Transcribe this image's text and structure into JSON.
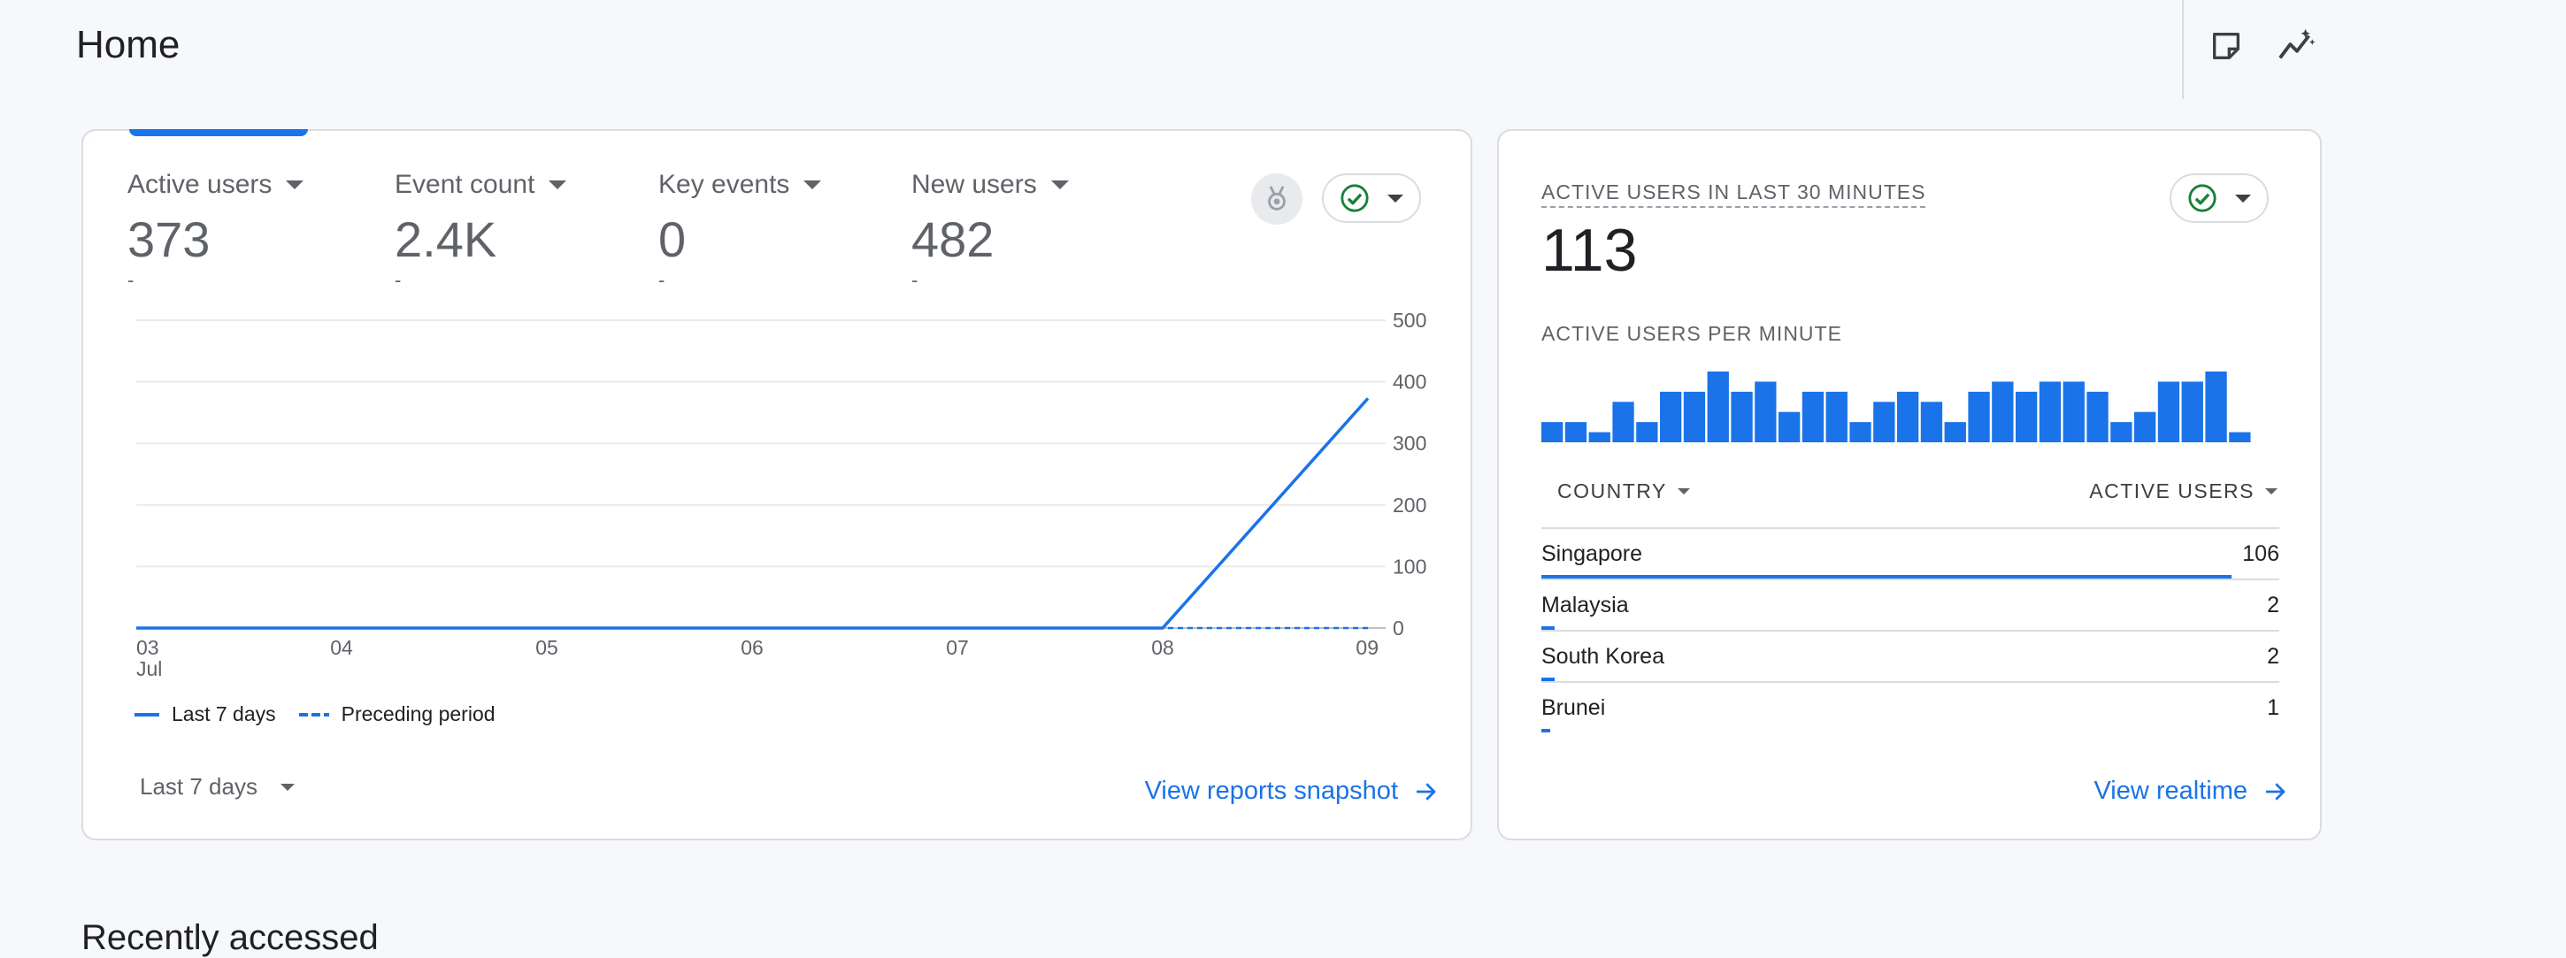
{
  "header": {
    "title": "Home",
    "icons": [
      "notes-icon",
      "insights-icon"
    ]
  },
  "colors": {
    "accent": "#1a73e8",
    "success": "#188038",
    "text": "#202124",
    "muted": "#5f6368"
  },
  "overview": {
    "metrics": [
      {
        "label": "Active users",
        "value": "373",
        "delta": "-",
        "active": true
      },
      {
        "label": "Event count",
        "value": "2.4K",
        "delta": "-",
        "active": false
      },
      {
        "label": "Key events",
        "value": "0",
        "delta": "-",
        "active": false
      },
      {
        "label": "New users",
        "value": "482",
        "delta": "-",
        "active": false
      }
    ],
    "legend": {
      "current": "Last 7 days",
      "previous": "Preceding period"
    },
    "date_range": "Last 7 days",
    "footer_link": "View reports snapshot"
  },
  "chart_data": {
    "type": "line",
    "x": [
      "03",
      "04",
      "05",
      "06",
      "07",
      "08",
      "09"
    ],
    "x_sublabel": "Jul",
    "ylim": [
      0,
      500
    ],
    "yticks": [
      0,
      100,
      200,
      300,
      400,
      500
    ],
    "series": [
      {
        "name": "Last 7 days",
        "values": [
          0,
          0,
          0,
          0,
          0,
          0,
          373
        ],
        "style": "solid"
      },
      {
        "name": "Preceding period",
        "values": [
          0,
          0,
          0,
          0,
          0,
          0,
          0
        ],
        "style": "dashed"
      }
    ],
    "grid": true,
    "legend_position": "bottom-left"
  },
  "realtime": {
    "title": "ACTIVE USERS IN LAST 30 MINUTES",
    "value": "113",
    "per_minute_label": "ACTIVE USERS PER MINUTE",
    "per_minute": [
      2,
      2,
      1,
      4,
      2,
      5,
      5,
      7,
      5,
      6,
      3,
      5,
      5,
      2,
      4,
      5,
      4,
      2,
      5,
      6,
      5,
      6,
      6,
      5,
      2,
      3,
      6,
      6,
      7,
      1
    ],
    "table": {
      "col_country": "COUNTRY",
      "col_users": "ACTIVE USERS",
      "rows": [
        {
          "country": "Singapore",
          "users": "106",
          "share": 106
        },
        {
          "country": "Malaysia",
          "users": "2",
          "share": 2
        },
        {
          "country": "South Korea",
          "users": "2",
          "share": 2
        },
        {
          "country": "Brunei",
          "users": "1",
          "share": 1
        }
      ]
    },
    "footer_link": "View realtime"
  },
  "recent": {
    "title": "Recently accessed"
  }
}
